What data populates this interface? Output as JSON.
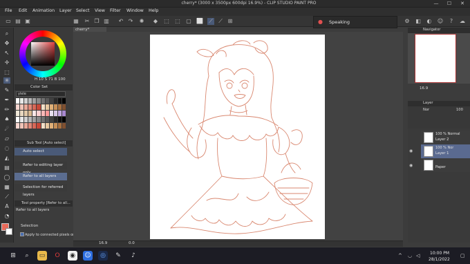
{
  "window": {
    "title": "cherry* (3000 x 3500px 600dpi 16.9%) - CLIP STUDIO PAINT PRO",
    "controls": [
      "—",
      "☐",
      "✕"
    ]
  },
  "menu": [
    "File",
    "Edit",
    "Animation",
    "Layer",
    "Select",
    "View",
    "Filter",
    "Window",
    "Help"
  ],
  "speaking_popup": {
    "label": "Speaking"
  },
  "document_tab": "cherry*",
  "color_wheel": {
    "readout": "H 10  S 71  B 100"
  },
  "color_set": {
    "title": "Color Set",
    "selected": "ylele"
  },
  "sub_tool": {
    "title": "Sub Tool [Auto select]",
    "items": [
      "Auto select",
      "Refer to editing layer only",
      "Refer to all layers",
      "Selection for referred layers"
    ]
  },
  "tool_property": {
    "title": "Tool property [Refer to all...",
    "value": "Refer to all layers"
  },
  "selection": {
    "label": "Selection",
    "apply_label": "Apply to connected pixels only"
  },
  "status": {
    "zoom": "16.9",
    "rotation": "0.0"
  },
  "navigator": {
    "title": "Navigator",
    "zoom": "16.9"
  },
  "layer_panel": {
    "title": "Layer",
    "blend_label": "Nor",
    "opacity_label": "100",
    "layers": [
      {
        "mode": "100 % Normal",
        "name": "Layer 2"
      },
      {
        "mode": "100 % Nor",
        "name": "Layer 1"
      },
      {
        "mode": "",
        "name": "Paper"
      }
    ]
  },
  "taskbar": {
    "time": "10:00 PM",
    "date": "28/1/2022"
  },
  "colors": {
    "accent_selected": "#5b6d90",
    "fg_color": "#e86a5a",
    "sketch_line": "#d9876f"
  }
}
